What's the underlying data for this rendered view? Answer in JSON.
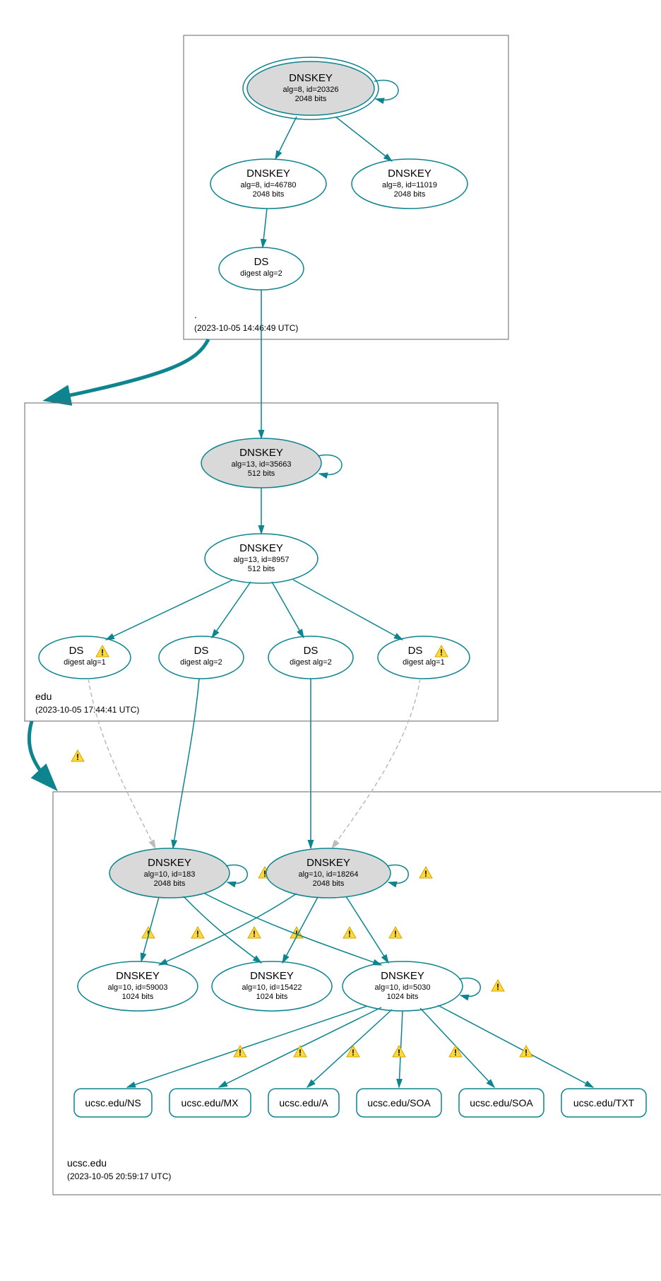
{
  "zones": {
    "root": {
      "label": ".",
      "timestamp": "(2023-10-05 14:46:49 UTC)"
    },
    "edu": {
      "label": "edu",
      "timestamp": "(2023-10-05 17:44:41 UTC)"
    },
    "ucsc": {
      "label": "ucsc.edu",
      "timestamp": "(2023-10-05 20:59:17 UTC)"
    }
  },
  "nodes": {
    "root_ksk": {
      "t": "DNSKEY",
      "s1": "alg=8, id=20326",
      "s2": "2048 bits"
    },
    "root_zsk1": {
      "t": "DNSKEY",
      "s1": "alg=8, id=46780",
      "s2": "2048 bits"
    },
    "root_zsk2": {
      "t": "DNSKEY",
      "s1": "alg=8, id=11019",
      "s2": "2048 bits"
    },
    "root_ds": {
      "t": "DS",
      "s1": "digest alg=2"
    },
    "edu_ksk": {
      "t": "DNSKEY",
      "s1": "alg=13, id=35663",
      "s2": "512 bits"
    },
    "edu_zsk": {
      "t": "DNSKEY",
      "s1": "alg=13, id=8957",
      "s2": "512 bits"
    },
    "edu_ds1": {
      "t": "DS",
      "s1": "digest alg=1"
    },
    "edu_ds2": {
      "t": "DS",
      "s1": "digest alg=2"
    },
    "edu_ds3": {
      "t": "DS",
      "s1": "digest alg=2"
    },
    "edu_ds4": {
      "t": "DS",
      "s1": "digest alg=1"
    },
    "ucsc_k183": {
      "t": "DNSKEY",
      "s1": "alg=10, id=183",
      "s2": "2048 bits"
    },
    "ucsc_k18264": {
      "t": "DNSKEY",
      "s1": "alg=10, id=18264",
      "s2": "2048 bits"
    },
    "ucsc_k59003": {
      "t": "DNSKEY",
      "s1": "alg=10, id=59003",
      "s2": "1024 bits"
    },
    "ucsc_k15422": {
      "t": "DNSKEY",
      "s1": "alg=10, id=15422",
      "s2": "1024 bits"
    },
    "ucsc_k5030": {
      "t": "DNSKEY",
      "s1": "alg=10, id=5030",
      "s2": "1024 bits"
    },
    "rr_ns": {
      "t": "ucsc.edu/NS"
    },
    "rr_mx": {
      "t": "ucsc.edu/MX"
    },
    "rr_a": {
      "t": "ucsc.edu/A"
    },
    "rr_soa1": {
      "t": "ucsc.edu/SOA"
    },
    "rr_soa2": {
      "t": "ucsc.edu/SOA"
    },
    "rr_txt": {
      "t": "ucsc.edu/TXT"
    }
  }
}
